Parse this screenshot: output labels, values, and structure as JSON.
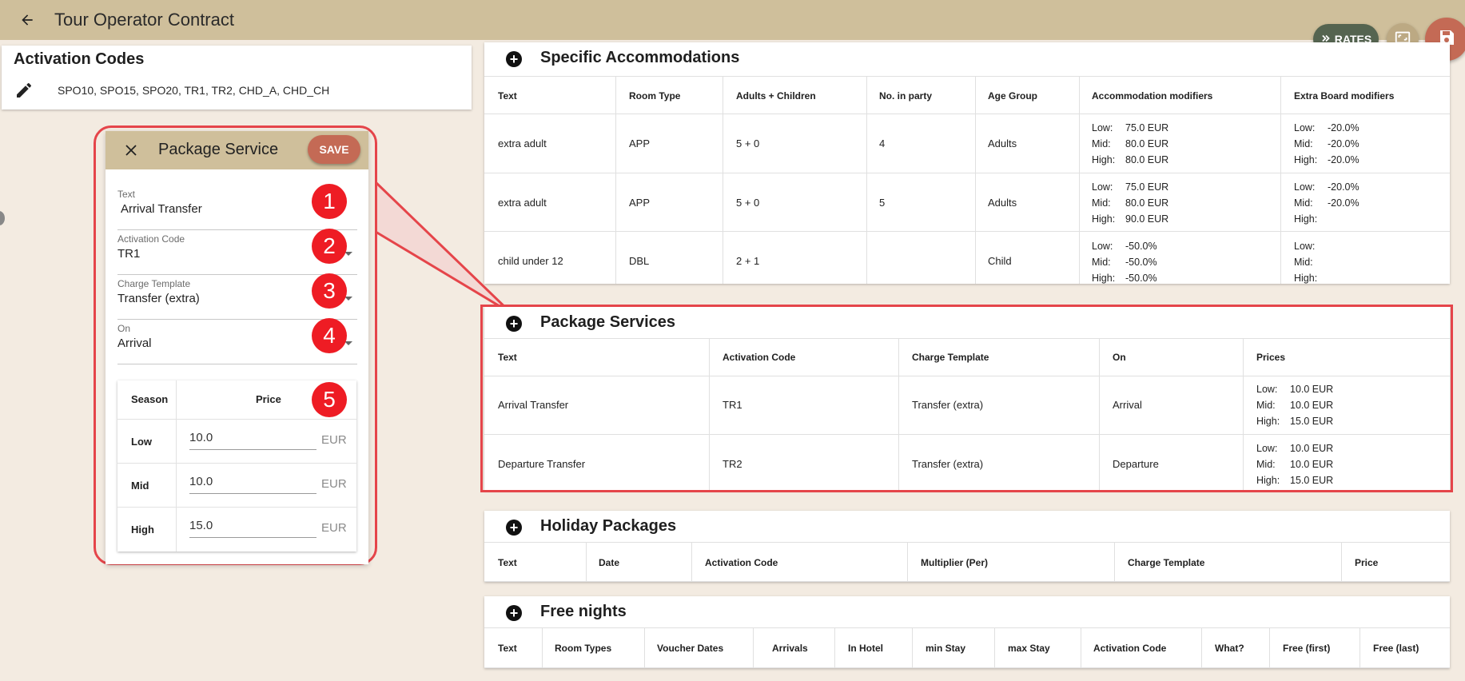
{
  "app": {
    "title": "Tour Operator Contract"
  },
  "fabs": {
    "rates_label": "RATES"
  },
  "activation_codes": {
    "title": "Activation Codes",
    "value": "SPO10, SPO15, SPO20, TR1, TR2, CHD_A, CHD_CH"
  },
  "dialog": {
    "title": "Package Service",
    "save_label": "SAVE",
    "fields": [
      {
        "label": "Text",
        "value": "Arrival Transfer"
      },
      {
        "label": "Activation Code",
        "value": "TR1"
      },
      {
        "label": "Charge Template",
        "value": "Transfer (extra)"
      },
      {
        "label": "On",
        "value": "Arrival"
      }
    ],
    "price_table": {
      "season_header": "Season",
      "price_header": "Price",
      "rows": [
        {
          "season": "Low",
          "price": "10.0",
          "unit": "EUR"
        },
        {
          "season": "Mid",
          "price": "10.0",
          "unit": "EUR"
        },
        {
          "season": "High",
          "price": "15.0",
          "unit": "EUR"
        }
      ]
    },
    "badges": [
      "1",
      "2",
      "3",
      "4",
      "5"
    ]
  },
  "specific_accommodations": {
    "title": "Specific Accommodations",
    "headers": [
      "Text",
      "Room Type",
      "Adults + Children",
      "No. in party",
      "Age Group",
      "Accommodation modifiers",
      "Extra Board modifiers"
    ],
    "rows": [
      {
        "text": "extra adult",
        "room_type": "APP",
        "adults_children": "5 + 0",
        "no_in_party": "4",
        "age_group": "Adults",
        "acc": {
          "low": "75.0 EUR",
          "mid": "80.0 EUR",
          "high": "80.0 EUR"
        },
        "board": {
          "low": "-20.0%",
          "mid": "-20.0%",
          "high": "-20.0%"
        }
      },
      {
        "text": "extra adult",
        "room_type": "APP",
        "adults_children": "5 + 0",
        "no_in_party": "5",
        "age_group": "Adults",
        "acc": {
          "low": "75.0 EUR",
          "mid": "80.0 EUR",
          "high": "90.0 EUR"
        },
        "board": {
          "low": "-20.0%",
          "mid": "-20.0%",
          "high": ""
        }
      },
      {
        "text": "child under 12",
        "room_type": "DBL",
        "adults_children": "2 + 1",
        "no_in_party": "",
        "age_group": "Child",
        "acc": {
          "low": "-50.0%",
          "mid": "-50.0%",
          "high": "-50.0%"
        },
        "board": {
          "low": "",
          "mid": "",
          "high": ""
        }
      }
    ],
    "season_labels": {
      "low": "Low:",
      "mid": "Mid:",
      "high": "High:"
    }
  },
  "package_services": {
    "title": "Package Services",
    "headers": [
      "Text",
      "Activation Code",
      "Charge Template",
      "On",
      "Prices"
    ],
    "rows": [
      {
        "text": "Arrival Transfer",
        "code": "TR1",
        "template": "Transfer (extra)",
        "on": "Arrival",
        "prices": {
          "low": "10.0 EUR",
          "mid": "10.0 EUR",
          "high": "15.0 EUR"
        }
      },
      {
        "text": "Departure Transfer",
        "code": "TR2",
        "template": "Transfer (extra)",
        "on": "Departure",
        "prices": {
          "low": "10.0 EUR",
          "mid": "10.0 EUR",
          "high": "15.0 EUR"
        }
      }
    ]
  },
  "holiday_packages": {
    "title": "Holiday Packages",
    "headers": [
      "Text",
      "Date",
      "Activation Code",
      "Multiplier (Per)",
      "Charge Template",
      "Price"
    ]
  },
  "free_nights": {
    "title": "Free nights",
    "headers": [
      "Text",
      "Room Types",
      "Voucher Dates",
      "Arrivals",
      "In Hotel",
      "min Stay",
      "max Stay",
      "Activation Code",
      "What?",
      "Free (first)",
      "Free (last)"
    ]
  }
}
